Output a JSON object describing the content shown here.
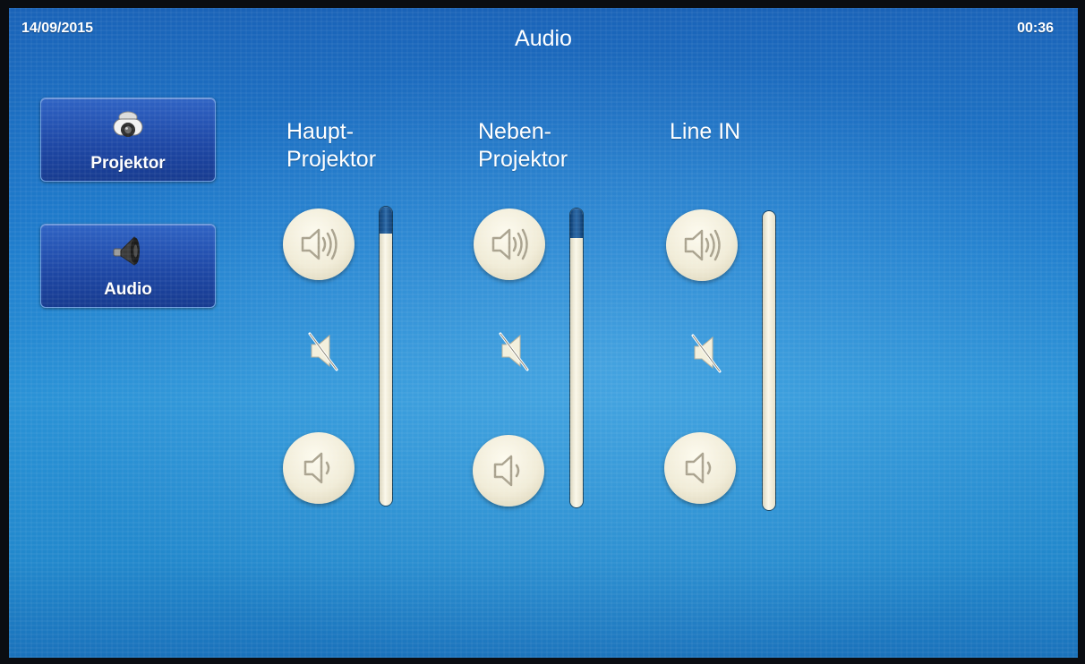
{
  "status": {
    "date": "14/09/2015",
    "time": "00:36"
  },
  "page": {
    "title": "Audio"
  },
  "nav": {
    "projektor": {
      "label": "Projektor",
      "icon": "projector-icon"
    },
    "audio": {
      "label": "Audio",
      "icon": "loudspeaker-icon"
    }
  },
  "channels": [
    {
      "label_line1": "Haupt-",
      "label_line2": "Projektor",
      "level": 0.91
    },
    {
      "label_line1": "Neben-",
      "label_line2": "Projektor",
      "level": 0.9
    },
    {
      "label_line1": "Line IN",
      "label_line2": "",
      "level": 1.0
    }
  ],
  "icons": {
    "volume_up": "volume-up-icon",
    "mute": "mute-icon",
    "volume_down": "volume-down-icon"
  },
  "colors": {
    "background": "#1f7ccc",
    "nav_button": "#1e48a6",
    "button_face": "#f1ecd8",
    "slider_fill": "#0d3e74"
  }
}
